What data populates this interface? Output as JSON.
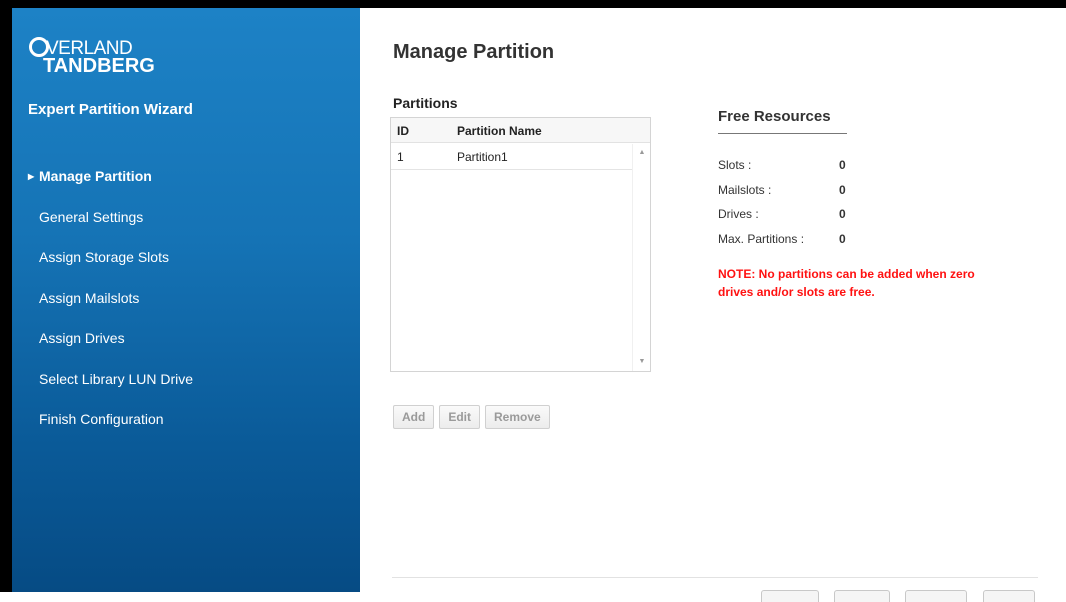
{
  "brand": {
    "logo_line1": "VERLAND",
    "logo_line2": "TANDBERG"
  },
  "sidebar": {
    "wizard_title": "Expert Partition Wizard",
    "items": [
      {
        "label": "Manage Partition",
        "active": true
      },
      {
        "label": "General Settings"
      },
      {
        "label": "Assign Storage Slots"
      },
      {
        "label": "Assign Mailslots"
      },
      {
        "label": "Assign Drives"
      },
      {
        "label": "Select Library LUN Drive"
      },
      {
        "label": "Finish Configuration"
      }
    ]
  },
  "main": {
    "title": "Manage Partition",
    "partitions_label": "Partitions",
    "table": {
      "columns": [
        "ID",
        "Partition Name"
      ],
      "rows": [
        {
          "id": "1",
          "name": "Partition1"
        }
      ]
    },
    "buttons": {
      "add": "Add",
      "edit": "Edit",
      "remove": "Remove"
    },
    "free_resources": {
      "title": "Free Resources",
      "items": [
        {
          "label": "Slots :",
          "value": "0"
        },
        {
          "label": "Mailslots :",
          "value": "0"
        },
        {
          "label": "Drives :",
          "value": "0"
        },
        {
          "label": "Max. Partitions :",
          "value": "0"
        }
      ],
      "note": "NOTE: No partitions can be added when zero drives and/or slots are free."
    }
  },
  "colors": {
    "sidebar_top": "#1d82c6",
    "sidebar_bottom": "#064b84",
    "note": "#ff1111"
  }
}
